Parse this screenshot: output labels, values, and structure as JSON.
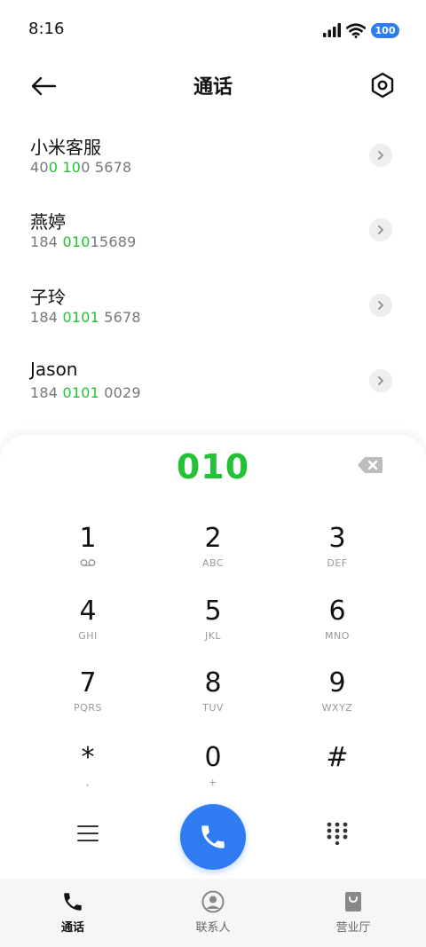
{
  "status_bar": {
    "time": "8:16",
    "battery": "100"
  },
  "header": {
    "title": "通话"
  },
  "contacts": [
    {
      "name": "小米客服",
      "number_parts": [
        "40",
        "0 10",
        "0 5678"
      ]
    },
    {
      "name": "燕婷",
      "number_parts": [
        "184 ",
        "010",
        "15689"
      ]
    },
    {
      "name": "子玲",
      "number_parts": [
        "184 ",
        "0101",
        " 5678"
      ]
    },
    {
      "name": "Jason",
      "number_parts": [
        "184 ",
        "0101",
        " 0029"
      ]
    }
  ],
  "dialer": {
    "number": "010",
    "keys": [
      {
        "digit": "1",
        "sub": ""
      },
      {
        "digit": "2",
        "sub": "ABC"
      },
      {
        "digit": "3",
        "sub": "DEF"
      },
      {
        "digit": "4",
        "sub": "GHI"
      },
      {
        "digit": "5",
        "sub": "JKL"
      },
      {
        "digit": "6",
        "sub": "MNO"
      },
      {
        "digit": "7",
        "sub": "PQRS"
      },
      {
        "digit": "8",
        "sub": "TUV"
      },
      {
        "digit": "9",
        "sub": "WXYZ"
      },
      {
        "digit": "*",
        "sub": ","
      },
      {
        "digit": "0",
        "sub": "+"
      },
      {
        "digit": "#",
        "sub": ""
      }
    ]
  },
  "bottom_nav": [
    {
      "label": "通话",
      "active": true
    },
    {
      "label": "联系人",
      "active": false
    },
    {
      "label": "营业厅",
      "active": false
    }
  ],
  "colors": {
    "accent_blue": "#2f7cf2",
    "match_green": "#22c236",
    "text_primary": "#111111",
    "text_secondary": "#777777"
  }
}
